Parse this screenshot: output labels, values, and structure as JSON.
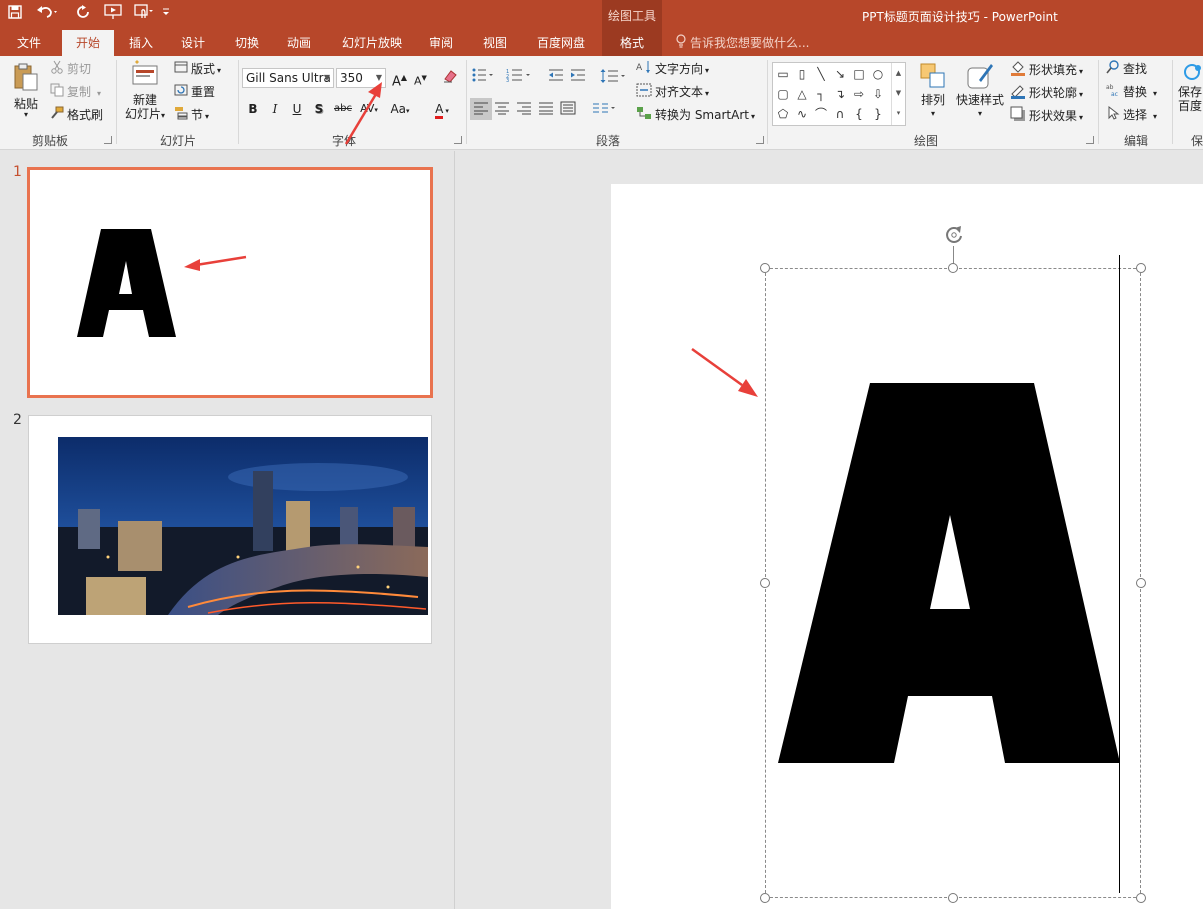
{
  "app": {
    "title": "PPT标题页面设计技巧 - PowerPoint",
    "contextual_group": "绘图工具",
    "tell_me": "告诉我您想要做什么...",
    "colors": {
      "accent": "#b7472a",
      "ribbon_bg": "#f3f3f3",
      "selection": "#e9734f",
      "annotation_arrow": "#e8403a"
    }
  },
  "quick_access": {
    "icons": [
      "save-icon",
      "undo-icon",
      "redo-icon",
      "start-slideshow-icon",
      "touch-mode-icon",
      "customize-qat-icon"
    ]
  },
  "tabs": [
    {
      "label": "文件",
      "active": false
    },
    {
      "label": "开始",
      "active": true
    },
    {
      "label": "插入",
      "active": false
    },
    {
      "label": "设计",
      "active": false
    },
    {
      "label": "切换",
      "active": false
    },
    {
      "label": "动画",
      "active": false
    },
    {
      "label": "幻灯片放映",
      "active": false
    },
    {
      "label": "审阅",
      "active": false
    },
    {
      "label": "视图",
      "active": false
    },
    {
      "label": "百度网盘",
      "active": false
    },
    {
      "label": "格式",
      "active": false,
      "contextual": true
    }
  ],
  "ribbon": {
    "clipboard": {
      "label": "剪贴板",
      "paste": "粘贴",
      "cut": "剪切",
      "copy": "复制",
      "format_painter": "格式刷"
    },
    "slides": {
      "label": "幻灯片",
      "new_slide_line1": "新建",
      "new_slide_line2": "幻灯片",
      "layout": "版式",
      "reset": "重置",
      "section": "节"
    },
    "font": {
      "label": "字体",
      "font_name": "Gill Sans Ultra",
      "font_size": "350",
      "bold": "B",
      "italic": "I",
      "underline": "U",
      "shadow": "S",
      "strike": "abc",
      "spacing": "AV",
      "case": "Aa",
      "color": "A"
    },
    "paragraph": {
      "label": "段落",
      "text_direction": "文字方向",
      "align_text": "对齐文本",
      "smartart": "转换为 SmartArt"
    },
    "drawing": {
      "label": "绘图",
      "arrange": "排列",
      "quick_styles": "快速样式",
      "shape_fill": "形状填充",
      "shape_outline": "形状轮廓",
      "shape_effects": "形状效果"
    },
    "editing": {
      "label": "编辑",
      "find": "查找",
      "replace": "替换",
      "select": "选择"
    },
    "baidu": {
      "label": "保",
      "save_line1": "保存",
      "save_line2": "百度"
    }
  },
  "thumbnails": [
    {
      "number": "1",
      "selected": true,
      "content": "A"
    },
    {
      "number": "2",
      "selected": false,
      "content": "city-night-photo"
    }
  ],
  "slide": {
    "big_letter": "A"
  }
}
